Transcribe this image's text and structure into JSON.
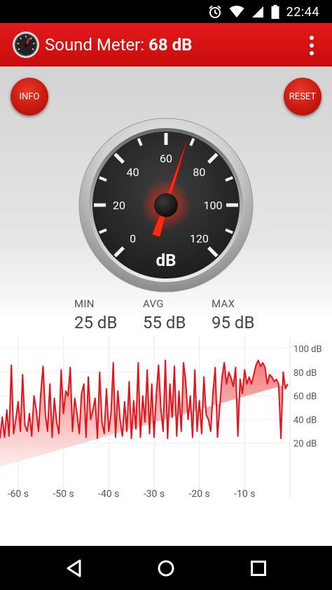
{
  "status_bar": {
    "time": "22:44",
    "icons": [
      "alarm-icon",
      "wifi-icon",
      "cell-signal-icon",
      "battery-icon"
    ]
  },
  "app_bar": {
    "title_prefix": "Sound Meter: ",
    "title_value": "68 dB",
    "logo": "speedometer-logo",
    "menu_icon": "overflow-menu-icon"
  },
  "buttons": {
    "info": "INFO",
    "reset": "RESET"
  },
  "gauge": {
    "unit": "dB",
    "ticks": [
      "0",
      "20",
      "40",
      "60",
      "80",
      "100",
      "120"
    ],
    "value": 68,
    "min": 0,
    "max": 120
  },
  "stats": [
    {
      "label": "MIN",
      "value": "25 dB"
    },
    {
      "label": "AVG",
      "value": "55 dB"
    },
    {
      "label": "MAX",
      "value": "95 dB"
    }
  ],
  "chart_data": {
    "type": "area",
    "x_unit": "s",
    "y_unit": "dB",
    "xlim": [
      -64,
      0
    ],
    "ylim": [
      0,
      100
    ],
    "x_ticks": [
      "-60 s",
      "-50 s",
      "-40 s",
      "-30 s",
      "-20 s",
      "-10 s"
    ],
    "y_ticks": [
      "100 dB",
      "80 dB",
      "60 dB",
      "40 dB",
      "20 dB"
    ],
    "grid": true,
    "color": "#e0161e",
    "x": [
      -64,
      -63.5,
      -63,
      -62.5,
      -62,
      -61.5,
      -61,
      -60.5,
      -60,
      -59.5,
      -59,
      -58.5,
      -58,
      -57.5,
      -57,
      -56.5,
      -56,
      -55.5,
      -55,
      -54.5,
      -54,
      -53.5,
      -53,
      -52.5,
      -52,
      -51.5,
      -51,
      -50.5,
      -50,
      -49.5,
      -49,
      -48.5,
      -48,
      -47.5,
      -47,
      -46.5,
      -46,
      -45.5,
      -45,
      -44.5,
      -44,
      -43.5,
      -43,
      -42.5,
      -42,
      -41.5,
      -41,
      -40.5,
      -40,
      -39.5,
      -39,
      -38.5,
      -38,
      -37.5,
      -37,
      -36.5,
      -36,
      -35.5,
      -35,
      -34.5,
      -34,
      -33.5,
      -33,
      -32.5,
      -32,
      -31.5,
      -31,
      -30.5,
      -30,
      -29.5,
      -29,
      -28.5,
      -28,
      -27.5,
      -27,
      -26.5,
      -26,
      -25.5,
      -25,
      -24.5,
      -24,
      -23.5,
      -23,
      -22.5,
      -22,
      -21.5,
      -21,
      -20.5,
      -20,
      -19.5,
      -19,
      -18.5,
      -18,
      -17.5,
      -17,
      -16.5,
      -16,
      -15.5,
      -15,
      -14.5,
      -14,
      -13.5,
      -13,
      -12.5,
      -12,
      -11.5,
      -11,
      -10.5,
      -10,
      -9.5,
      -9,
      -8.5,
      -8,
      -7.5,
      -7,
      -6.5,
      -6,
      -5.5,
      -5,
      -4.5,
      -4,
      -3.5,
      -3,
      -2.5,
      -2,
      -1.5,
      -1,
      -0.5,
      0
    ],
    "values": [
      24,
      42,
      25,
      48,
      26,
      86,
      28,
      40,
      55,
      30,
      78,
      35,
      30,
      45,
      26,
      60,
      48,
      30,
      62,
      85,
      45,
      30,
      70,
      25,
      58,
      38,
      28,
      82,
      45,
      64,
      60,
      84,
      30,
      58,
      45,
      28,
      62,
      70,
      25,
      76,
      40,
      48,
      58,
      24,
      80,
      38,
      28,
      66,
      30,
      45,
      88,
      25,
      64,
      40,
      26,
      55,
      30,
      72,
      24,
      56,
      32,
      88,
      25,
      60,
      38,
      82,
      28,
      70,
      25,
      62,
      86,
      50,
      30,
      90,
      24,
      70,
      42,
      85,
      26,
      64,
      30,
      88,
      72,
      40,
      60,
      25,
      82,
      30,
      56,
      28,
      76,
      44,
      40,
      30,
      62,
      84,
      25,
      50,
      76,
      88,
      70,
      80,
      75,
      68,
      84,
      26,
      74,
      62,
      82,
      70,
      76,
      70,
      78,
      86,
      90,
      85,
      88,
      84,
      70,
      78,
      76,
      72,
      74,
      70,
      24,
      80,
      66,
      70
    ]
  },
  "nav_bar": {
    "icons": [
      "back-icon",
      "home-icon",
      "recents-icon"
    ]
  }
}
